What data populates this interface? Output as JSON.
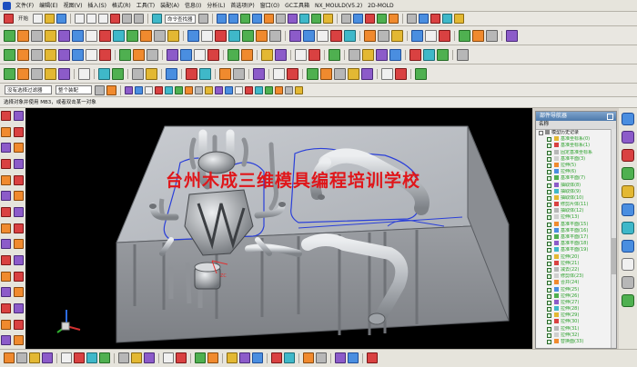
{
  "menubar": {
    "items": [
      "文件(F)",
      "编辑(E)",
      "视图(V)",
      "插入(S)",
      "格式(R)",
      "工具(T)",
      "装配(A)",
      "信息(I)",
      "分析(L)",
      "首选项(P)",
      "窗口(O)",
      "GC工具箱",
      "NX_MOULD(V5.2)",
      "2D-MOLD"
    ]
  },
  "toolbar1": {
    "start_label": "开始",
    "command_finder": "命令查找器"
  },
  "selrow": {
    "filter_value": "没有选择过滤器",
    "scope_value": "整个装配",
    "prompt": "选择对象并使用 MB3，或者双击某一对象"
  },
  "watermark": "台州木成三维模具编程培训学校",
  "navigator": {
    "title": "部件导航器",
    "column": "名称",
    "root": "模型历史记录",
    "rows": [
      "基准坐标系(0)",
      "基准坐标系(1)",
      "固定基准坐标系",
      "基准平面(3)",
      "拉伸(5)",
      "拉伸(6)",
      "基准平面(7)",
      "抽取体(8)",
      "抽取体(9)",
      "抽取体(10)",
      "修剪片体(11)",
      "抽取体(12)",
      "拉伸(13)",
      "基准平面(15)",
      "基准平面(16)",
      "基准平面(17)",
      "基准平面(18)",
      "基准平面(19)",
      "拉伸(20)",
      "拉伸(21)",
      "减去(22)",
      "修剪体(23)",
      "合并(24)",
      "拉伸(25)",
      "拉伸(26)",
      "拉伸(27)",
      "拉伸(28)",
      "拉伸(29)",
      "拉伸(30)",
      "拉伸(31)",
      "拉伸(32)",
      "替换面(33)"
    ]
  },
  "colors": {
    "viewport_bg": "#000000",
    "block_top": "#b8bcc2",
    "block_side": "#8e9197",
    "watermark": "#e0161a",
    "tree_text": "#2ea12e"
  }
}
